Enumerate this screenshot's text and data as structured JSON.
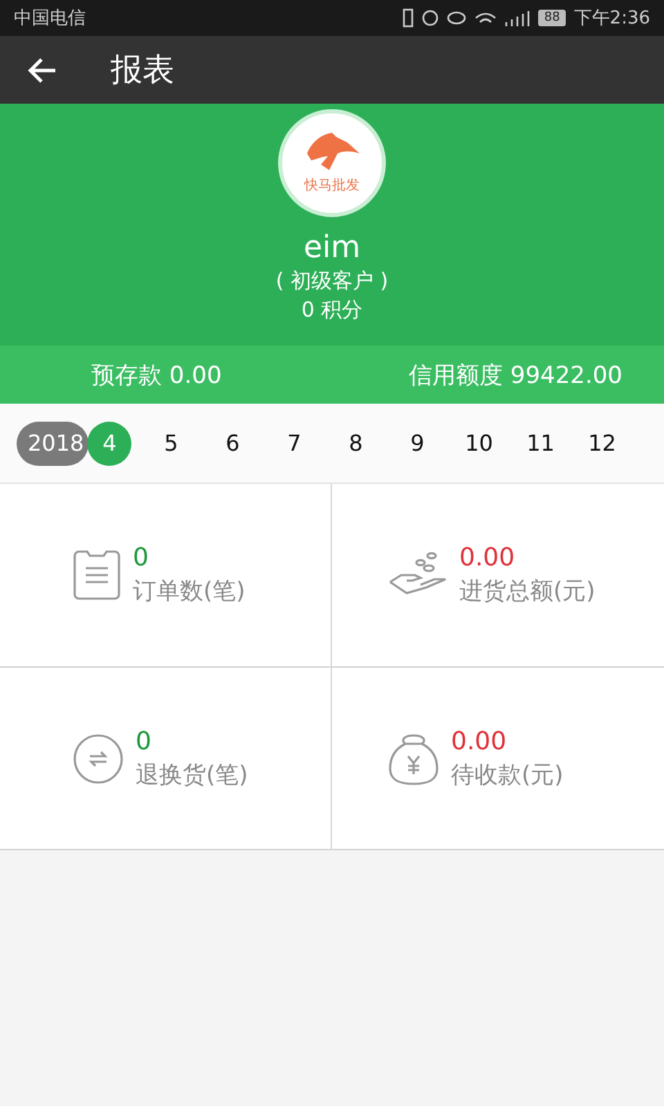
{
  "status_bar": {
    "carrier": "中国电信",
    "battery": "88",
    "time": "下午2:36"
  },
  "app_bar": {
    "title": "报表"
  },
  "profile": {
    "logo_text": "快马批发",
    "name": "eim",
    "level": "( 初级客户 )",
    "points": "0 积分"
  },
  "balances": [
    {
      "label": "预存款 0.00"
    },
    {
      "label": "信用额度 99422.00"
    }
  ],
  "period": {
    "year": "2018",
    "months": [
      {
        "label": "4",
        "selected": true
      },
      {
        "label": "5",
        "selected": false
      },
      {
        "label": "6",
        "selected": false
      },
      {
        "label": "7",
        "selected": false
      },
      {
        "label": "8",
        "selected": false
      },
      {
        "label": "9",
        "selected": false
      },
      {
        "label": "10",
        "selected": false
      },
      {
        "label": "11",
        "selected": false
      },
      {
        "label": "12",
        "selected": false
      }
    ]
  },
  "stats": [
    {
      "kind": "orders",
      "value": "0",
      "label": "订单数(笔)",
      "color": "#1e9a3e"
    },
    {
      "kind": "purchase",
      "value": "0.00",
      "label": "进货总额(元)",
      "color": "#e0323a"
    },
    {
      "kind": "returns",
      "value": "0",
      "label": "退换货(笔)",
      "color": "#1e9a3e"
    },
    {
      "kind": "receivable",
      "value": "0.00",
      "label": "待收款(元)",
      "color": "#e0323a"
    }
  ]
}
